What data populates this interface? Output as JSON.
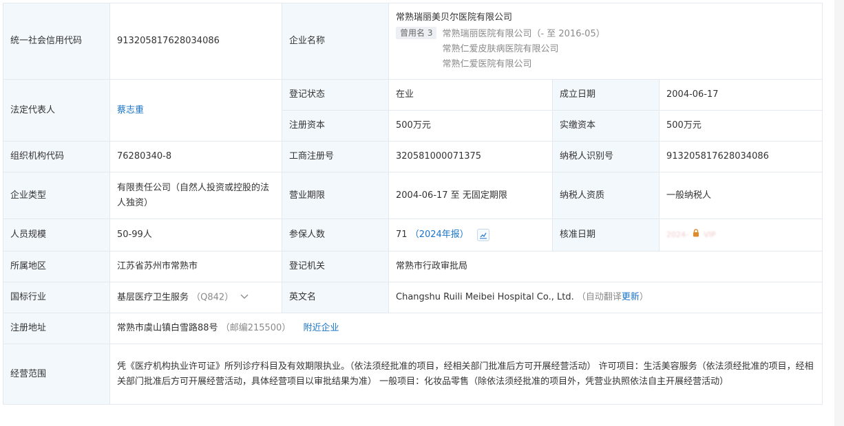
{
  "labels": {
    "credit_code": "统一社会信用代码",
    "company_name": "企业名称",
    "legal_rep": "法定代表人",
    "reg_status": "登记状态",
    "est_date": "成立日期",
    "reg_capital": "注册资本",
    "paid_capital": "实缴资本",
    "org_code": "组织机构代码",
    "biz_reg_no": "工商注册号",
    "taxpayer_id": "纳税人识别号",
    "company_type": "企业类型",
    "biz_term": "营业期限",
    "taxpayer_qual": "纳税人资质",
    "staff_size": "人员规模",
    "insured_count": "参保人数",
    "approval_date": "核准日期",
    "region": "所属地区",
    "reg_authority": "登记机关",
    "industry": "国标行业",
    "english_name": "英文名",
    "reg_address": "注册地址",
    "biz_scope": "经营范围"
  },
  "values": {
    "credit_code": "913205817628034086",
    "company_name": "常熟瑞丽美贝尔医院有限公司",
    "former_tag": "曾用名 3",
    "former_names": [
      "常熟瑞丽医院有限公司（- 至 2016-05）",
      "常熟仁爱皮肤病医院有限公司",
      "常熟仁爱医院有限公司"
    ],
    "legal_rep": "蔡志重",
    "reg_status": "在业",
    "est_date": "2004-06-17",
    "reg_capital": "500万元",
    "paid_capital": "500万元",
    "org_code": "76280340-8",
    "biz_reg_no": "320581000071375",
    "taxpayer_id": "913205817628034086",
    "company_type": "有限责任公司（自然人投资或控股的法人独资）",
    "biz_term": "2004-06-17 至 无固定期限",
    "taxpayer_qual": "一般纳税人",
    "staff_size": "50-99人",
    "insured_count": "71",
    "insured_report": "（2024年报）",
    "approval_blur": "VIP",
    "region": "江苏省苏州市常熟市",
    "reg_authority": "常熟市行政审批局",
    "industry": "基层医疗卫生服务",
    "industry_code": "（Q842）",
    "english_name": "Changshu Ruili Meibei Hospital Co., Ltd.",
    "auto_translate_prefix": "（自动翻译",
    "auto_translate_link": "更新",
    "auto_translate_suffix": "）",
    "reg_address": "常熟市虞山镇白雪路88号",
    "postcode": "（邮编215500）",
    "nearby_link": "附近企业",
    "biz_scope": "凭《医疗机构执业许可证》所列诊疗科目及有效期限执业。（依法须经批准的项目，经相关部门批准后方可开展经营活动） 许可项目：生活美容服务（依法须经批准的项目，经相关部门批准后方可开展经营活动，具体经营项目以审批结果为准） 一般项目：化妆品零售（除依法须经批准的项目外，凭营业执照依法自主开展经营活动）"
  },
  "colors": {
    "label_bg": "#f3f8fd",
    "border": "#e4e9ef",
    "link": "#1a73c9",
    "lock": "#e08a2c"
  },
  "icons": [
    "trend-chart-icon",
    "chevron-down-icon",
    "lock-icon"
  ]
}
